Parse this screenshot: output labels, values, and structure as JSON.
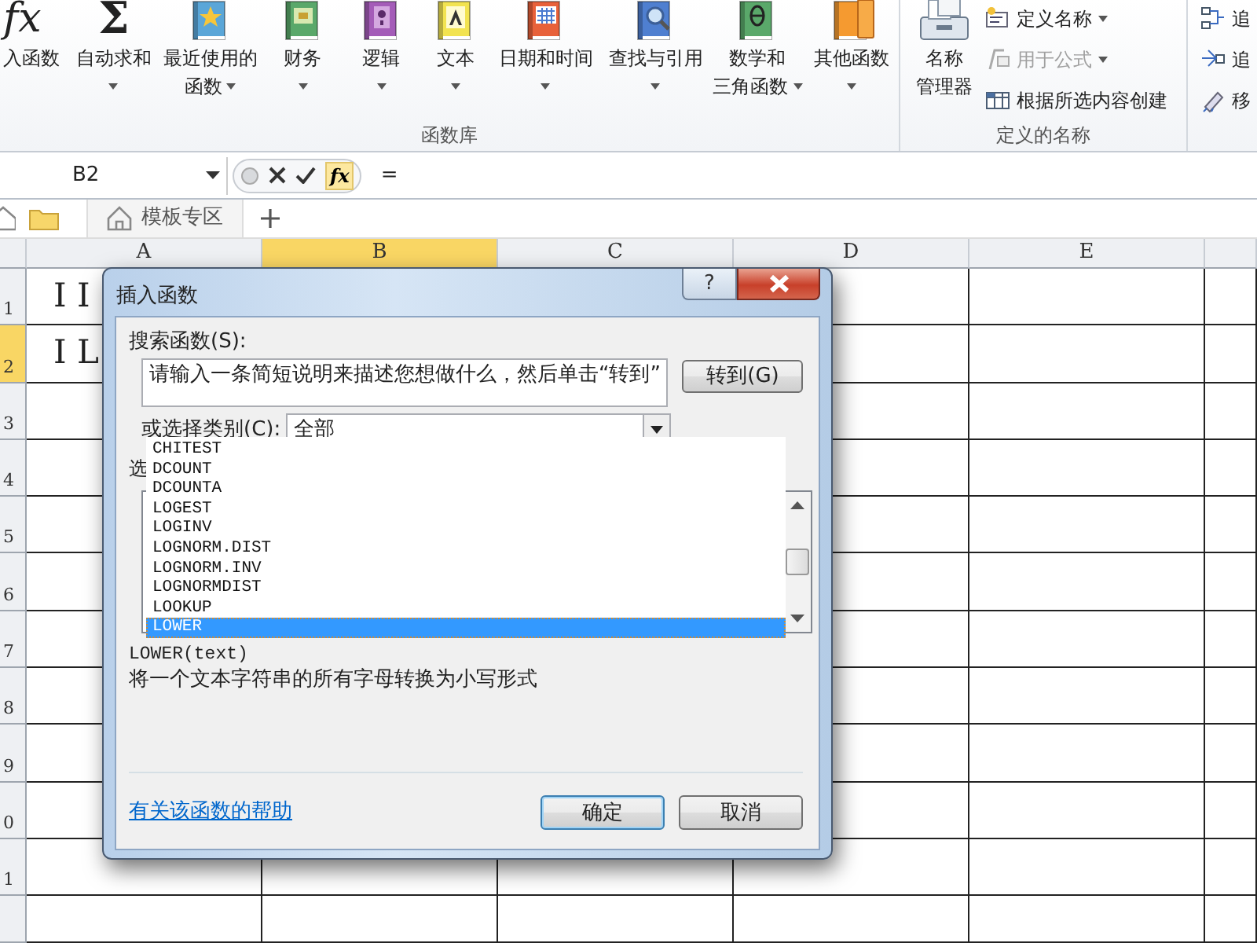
{
  "ribbon": {
    "groups": [
      {
        "label": "函数库",
        "buttons": [
          {
            "kind": "glyph",
            "glyph": "fx",
            "lines": [
              "入函数"
            ],
            "dropdown": false
          },
          {
            "kind": "glyph",
            "glyph": "Σ",
            "lines": [
              "自动求和"
            ],
            "dropdown": true
          },
          {
            "kind": "star",
            "lines": [
              "最近使用的",
              "函数"
            ],
            "dropdown": true
          },
          {
            "kind": "money",
            "lines": [
              "财务"
            ],
            "dropdown": true
          },
          {
            "kind": "question",
            "lines": [
              "逻辑"
            ],
            "dropdown": true
          },
          {
            "kind": "letter",
            "lines": [
              "文本"
            ],
            "dropdown": true
          },
          {
            "kind": "calendar",
            "lines": [
              "日期和时间"
            ],
            "dropdown": true
          },
          {
            "kind": "search",
            "lines": [
              "查找与引用"
            ],
            "dropdown": true
          },
          {
            "kind": "theta",
            "lines": [
              "数学和",
              "三角函数"
            ],
            "dropdown": true
          },
          {
            "kind": "books",
            "lines": [
              "其他函数"
            ],
            "dropdown": true
          }
        ]
      },
      {
        "label": "定义的名称",
        "buttons": [
          {
            "kind": "name-manager",
            "lines": [
              "名称",
              "管理器"
            ],
            "dropdown": false
          }
        ],
        "items": [
          {
            "kind": "define",
            "label": "定义名称",
            "dropdown": true,
            "disabled": false
          },
          {
            "kind": "formula",
            "label": "用于公式",
            "dropdown": true,
            "disabled": true
          },
          {
            "kind": "create",
            "label": "根据所选内容创建",
            "dropdown": false,
            "disabled": false
          }
        ]
      },
      {
        "items": [
          {
            "kind": "trace",
            "label": "追"
          },
          {
            "kind": "trace2",
            "label": "追"
          },
          {
            "kind": "remove",
            "label": "移"
          }
        ]
      }
    ]
  },
  "formula_bar": {
    "name_box": "B2",
    "insert_function": "fx",
    "formula": "="
  },
  "tab_bar": {
    "tabs": [
      {
        "label": "模板专区"
      }
    ]
  },
  "sheet": {
    "columns": [
      {
        "label": "A",
        "selected": false
      },
      {
        "label": "B",
        "selected": true
      },
      {
        "label": "C",
        "selected": false
      },
      {
        "label": "D",
        "selected": false
      },
      {
        "label": "E",
        "selected": false
      }
    ],
    "rows": [
      {
        "label": "1",
        "selected": false,
        "cells": [
          "I I"
        ]
      },
      {
        "label": "2",
        "selected": true,
        "cells": [
          "I L"
        ]
      },
      {
        "label": "3",
        "selected": false,
        "cells": []
      },
      {
        "label": "4",
        "selected": false,
        "cells": []
      },
      {
        "label": "5",
        "selected": false,
        "cells": []
      },
      {
        "label": "6",
        "selected": false,
        "cells": []
      },
      {
        "label": "7",
        "selected": false,
        "cells": []
      },
      {
        "label": "8",
        "selected": false,
        "cells": []
      },
      {
        "label": "9",
        "selected": false,
        "cells": []
      },
      {
        "label": "0",
        "selected": false,
        "cells": []
      },
      {
        "label": "1",
        "selected": false,
        "cells": []
      }
    ]
  },
  "dialog": {
    "title": "插入函数",
    "help_button": "?",
    "search_label": "搜索函数(S):",
    "search_value": "请输入一条简短说明来描述您想做什么，然后单击“转到”",
    "go_button": "转到(G)",
    "category_label": "或选择类别(C):",
    "category_value": "全部",
    "select_label": "选",
    "functions": [
      {
        "name": "CHITEST",
        "selected": false
      },
      {
        "name": "DCOUNT",
        "selected": false
      },
      {
        "name": "DCOUNTA",
        "selected": false
      },
      {
        "name": "LOGEST",
        "selected": false
      },
      {
        "name": "LOGINV",
        "selected": false
      },
      {
        "name": "LOGNORM.DIST",
        "selected": false
      },
      {
        "name": "LOGNORM.INV",
        "selected": false
      },
      {
        "name": "LOGNORMDIST",
        "selected": false
      },
      {
        "name": "LOOKUP",
        "selected": false
      },
      {
        "name": "LOWER",
        "selected": true
      }
    ],
    "signature": "LOWER(text)",
    "description": "将一个文本字符串的所有字母转换为小写形式",
    "help_link": "有关该函数的帮助",
    "ok_button": "确定",
    "cancel_button": "取消"
  }
}
